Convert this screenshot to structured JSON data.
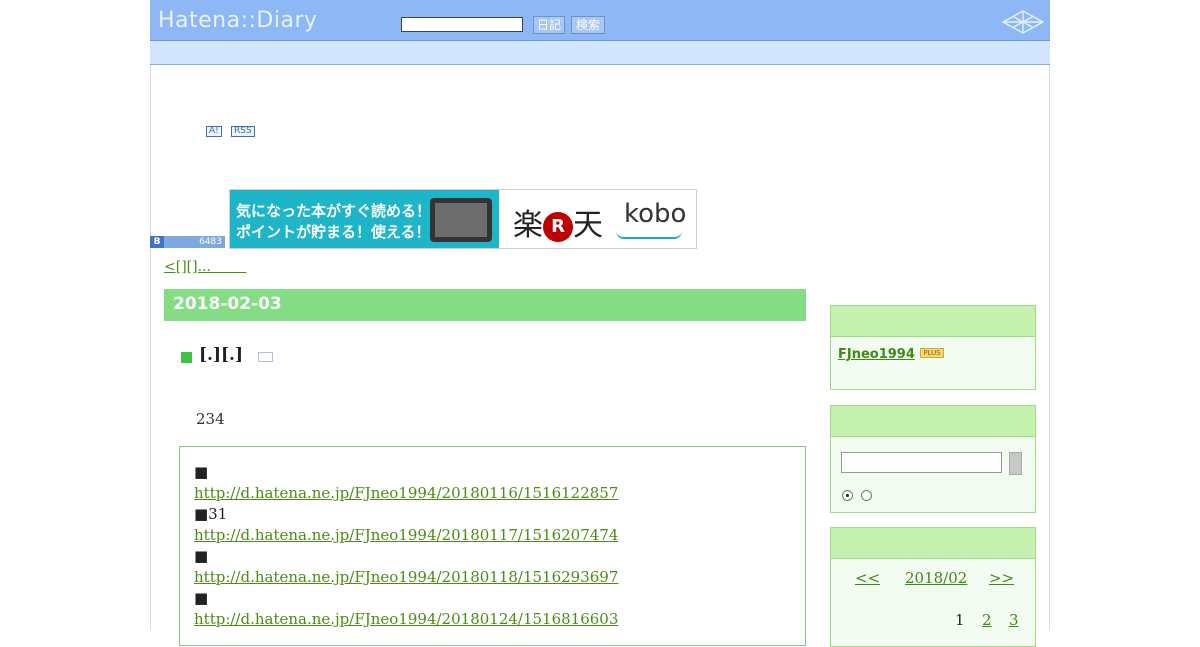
{
  "colors": {
    "topbar_bg": "#8db8f5",
    "subbar_bg": "#d2e4fb",
    "date_header_bg": "#84dc84",
    "sidebar_head_bg": "#c4f0b0",
    "link": "#4a8d15",
    "ad_bg": "#1eb5c9"
  },
  "header": {
    "logo": "Hatena::Diary",
    "search_value": "",
    "diary_button": "日記",
    "search_button": "検索",
    "logo_mark_icon": "hatena-mark-icon"
  },
  "badges": {
    "ai": "A!",
    "rss": "RSS"
  },
  "bookmark": {
    "icon_label": "B",
    "count": "6483"
  },
  "ad": {
    "line1": "気になった本がすぐ読める！",
    "line2": "ポイントが貯まる！使える！",
    "brand_raku": "楽",
    "brand_r": "R",
    "brand_ten": "天",
    "brand_kobo": "kobo"
  },
  "nav": {
    "prev_link": "<[][]...        "
  },
  "entry": {
    "date": "2018-02-03",
    "title": "[.][.]",
    "body": "234",
    "quote_lines": [
      {
        "marker": "■",
        "link": "http://d.hatena.ne.jp/FJneo1994/20180116/1516122857"
      },
      {
        "marker": "■31",
        "link": "http://d.hatena.ne.jp/FJneo1994/20180117/1516207474"
      },
      {
        "marker": "■",
        "link": "http://d.hatena.ne.jp/FJneo1994/20180118/1516293697"
      },
      {
        "marker": "■",
        "link": "http://d.hatena.ne.jp/FJneo1994/20180124/1516816603"
      }
    ]
  },
  "sidebar": {
    "profile": {
      "username": "FJneo1994",
      "plus_badge": "PLUS"
    },
    "search": {
      "value": ""
    },
    "calendar": {
      "prev": "<<",
      "month": "2018/02",
      "next": ">>",
      "days": [
        "1",
        "2",
        "3"
      ]
    }
  }
}
